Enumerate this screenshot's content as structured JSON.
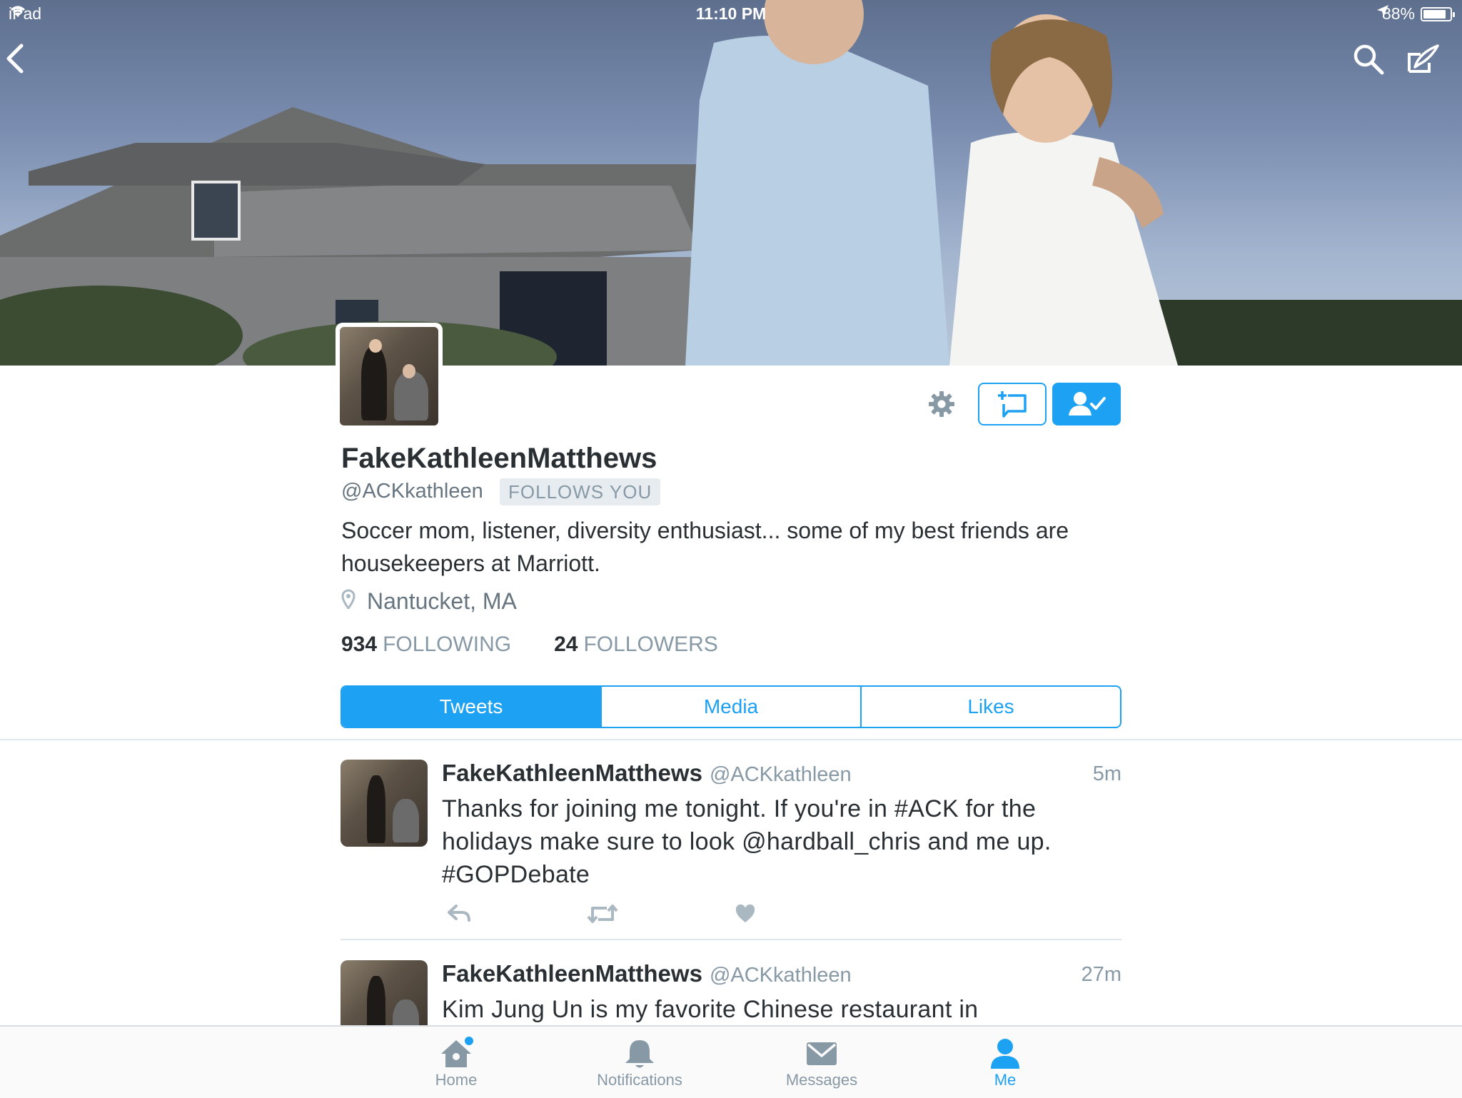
{
  "status_bar": {
    "device": "iPad",
    "time": "11:10 PM",
    "battery": "88%",
    "battery_level": 0.88
  },
  "header": {
    "icons": [
      "back-icon",
      "search-icon",
      "compose-icon"
    ]
  },
  "profile": {
    "display_name": "FakeKathleenMatthews",
    "handle": "@ACKkathleen",
    "follows_you": "FOLLOWS YOU",
    "bio": "Soccer mom, listener, diversity enthusiast... some of my best friends are housekeepers at Marriott.",
    "location": "Nantucket, MA",
    "following_count": "934",
    "following_label": "FOLLOWING",
    "followers_count": "24",
    "followers_label": "FOLLOWERS"
  },
  "tabs": [
    {
      "label": "Tweets",
      "active": true
    },
    {
      "label": "Media",
      "active": false
    },
    {
      "label": "Likes",
      "active": false
    }
  ],
  "tweets": [
    {
      "name": "FakeKathleenMatthews",
      "handle": "@ACKkathleen",
      "time": "5m",
      "text": "Thanks for joining me tonight.  If you're in #ACK for the holidays make sure to look @hardball_chris and me up. #GOPDebate"
    },
    {
      "name": "FakeKathleenMatthews",
      "handle": "@ACKkathleen",
      "time": "27m",
      "text": "Kim Jung Un is my favorite Chinese restaurant in"
    }
  ],
  "tabbar": [
    {
      "label": "Home",
      "icon": "home-icon",
      "active": false,
      "has_dot": true
    },
    {
      "label": "Notifications",
      "icon": "bell-icon",
      "active": false
    },
    {
      "label": "Messages",
      "icon": "envelope-icon",
      "active": false
    },
    {
      "label": "Me",
      "icon": "person-icon",
      "active": true
    }
  ],
  "colors": {
    "accent": "#1da1f2",
    "text": "#292f33",
    "muted": "#8899a6"
  }
}
